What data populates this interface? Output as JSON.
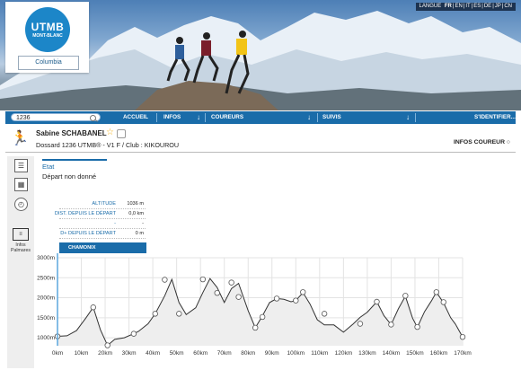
{
  "brand": {
    "logo_text": "UTMB",
    "logo_subtext": "MONT-BLANC",
    "sponsor": "Columbia"
  },
  "language_bar": {
    "label": "LANGUE",
    "languages": [
      "FR",
      "EN",
      "IT",
      "ES",
      "DE",
      "JP",
      "CN"
    ],
    "current": "FR"
  },
  "search": {
    "value": "1236"
  },
  "nav": {
    "items": [
      "ACCUEIL",
      "INFOS",
      "COUREURS",
      "SUIVIS",
      "S'IDENTIFIER..."
    ]
  },
  "runner": {
    "name": "Sabine SCHABANEL",
    "meta": "Dossard 1236   UTMB® - V1 F   /   Club : KIKOUROU",
    "infos_label": "INFOS COUREUR"
  },
  "sidebar": {
    "palmares_label_1": "Infos",
    "palmares_label_2": "Palmares"
  },
  "status": {
    "label": "Etat",
    "value": "Départ non donné"
  },
  "info_table": [
    {
      "key": "ALTITUDE",
      "value": "1036 m"
    },
    {
      "key": "DIST. DEPUIS LE DÉPART",
      "value": "0,0 km"
    },
    {
      "key": "-",
      "value": "-"
    },
    {
      "key": "D+ DEPUIS LE DÉPART",
      "value": "0 m"
    },
    {
      "key": "-",
      "value": "-"
    }
  ],
  "location_label": "CHAMONIX",
  "chart_data": {
    "type": "area",
    "xlim": [
      0,
      170
    ],
    "ylim": [
      800,
      3000
    ],
    "x_ticks": [
      0,
      10,
      20,
      30,
      40,
      50,
      60,
      70,
      80,
      90,
      100,
      110,
      120,
      130,
      140,
      150,
      160,
      170
    ],
    "x_tick_labels": [
      "0km",
      "10km",
      "20km",
      "30km",
      "40km",
      "50km",
      "60km",
      "70km",
      "80km",
      "90km",
      "100km",
      "110km",
      "120km",
      "130km",
      "140km",
      "150km",
      "160km",
      "170km"
    ],
    "y_ticks": [
      1000,
      1500,
      2000,
      2500,
      3000
    ],
    "y_tick_labels": [
      "1000m",
      "1500m",
      "2000m",
      "2500m",
      "3000m"
    ],
    "grid": true,
    "profile": [
      [
        0,
        1035
      ],
      [
        4,
        1050
      ],
      [
        8,
        1180
      ],
      [
        12,
        1500
      ],
      [
        15,
        1760
      ],
      [
        18,
        1200
      ],
      [
        21,
        810
      ],
      [
        24,
        960
      ],
      [
        28,
        1000
      ],
      [
        32,
        1100
      ],
      [
        34,
        1160
      ],
      [
        38,
        1350
      ],
      [
        41,
        1600
      ],
      [
        45,
        2050
      ],
      [
        48,
        2460
      ],
      [
        51,
        1880
      ],
      [
        54,
        1580
      ],
      [
        58,
        1750
      ],
      [
        61,
        2130
      ],
      [
        64,
        2480
      ],
      [
        67,
        2260
      ],
      [
        70,
        1880
      ],
      [
        73,
        2230
      ],
      [
        76,
        2360
      ],
      [
        80,
        1680
      ],
      [
        83,
        1250
      ],
      [
        86,
        1550
      ],
      [
        89,
        1880
      ],
      [
        92,
        1980
      ],
      [
        95,
        1960
      ],
      [
        98,
        1900
      ],
      [
        100,
        1930
      ],
      [
        103,
        2130
      ],
      [
        106,
        1840
      ],
      [
        109,
        1450
      ],
      [
        112,
        1320
      ],
      [
        116,
        1320
      ],
      [
        120,
        1140
      ],
      [
        124,
        1340
      ],
      [
        127,
        1510
      ],
      [
        130,
        1640
      ],
      [
        134,
        1900
      ],
      [
        137,
        1550
      ],
      [
        140,
        1330
      ],
      [
        143,
        1720
      ],
      [
        146,
        2040
      ],
      [
        149,
        1490
      ],
      [
        151,
        1260
      ],
      [
        154,
        1650
      ],
      [
        157,
        1930
      ],
      [
        159,
        2140
      ],
      [
        162,
        1870
      ],
      [
        165,
        1500
      ],
      [
        167,
        1340
      ],
      [
        170,
        1020
      ]
    ],
    "waypoints": [
      [
        0,
        1035
      ],
      [
        15,
        1760
      ],
      [
        21,
        810
      ],
      [
        32,
        1100
      ],
      [
        41,
        1600
      ],
      [
        45,
        2450
      ],
      [
        51,
        1600
      ],
      [
        61,
        2460
      ],
      [
        67,
        2120
      ],
      [
        73,
        2380
      ],
      [
        76,
        2020
      ],
      [
        83,
        1250
      ],
      [
        86,
        1520
      ],
      [
        92,
        1980
      ],
      [
        100,
        1930
      ],
      [
        103,
        2140
      ],
      [
        112,
        1600
      ],
      [
        127,
        1350
      ],
      [
        134,
        1900
      ],
      [
        140,
        1330
      ],
      [
        146,
        2050
      ],
      [
        151,
        1270
      ],
      [
        159,
        2140
      ],
      [
        162,
        1890
      ],
      [
        170,
        1020
      ]
    ],
    "fill_color": "#eeeeee",
    "line_color": "#333333"
  }
}
